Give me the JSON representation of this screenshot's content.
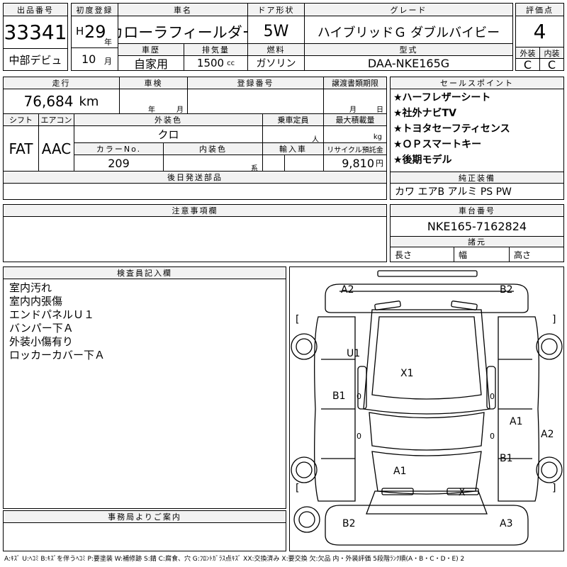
{
  "header": {
    "lot_label": "出品番号",
    "lot_no": "33341",
    "venue": "中部デビュ",
    "first_reg_label": "初度登録",
    "era": "H",
    "year": "29",
    "year_unit": "年",
    "month": "10",
    "month_unit": "月",
    "car_name_label": "車名",
    "car_name": "カローラフィールダー",
    "door_label": "ドア形状",
    "door": "5W",
    "grade_label": "グレード",
    "grade": "ハイブリッドＧ ダブルバイビー",
    "score_label": "評価点",
    "score": "4",
    "history_label": "車歴",
    "history": "自家用",
    "displacement_label": "排気量",
    "displacement": "1500",
    "displacement_unit": "cc",
    "fuel_label": "燃料",
    "fuel": "ガソリン",
    "model_label": "型式",
    "model": "DAA-NKE165G",
    "ext_label": "外装",
    "ext": "C",
    "int_label": "内装",
    "int": "C"
  },
  "specs": {
    "mileage_label": "走行",
    "mileage": "76,684",
    "mileage_unit": "km",
    "inspection_label": "車検",
    "insp_year_unit": "年",
    "insp_month_unit": "月",
    "reg_no_label": "登録番号",
    "transfer_label": "譲渡書類期限",
    "transfer_month_unit": "月",
    "transfer_day_unit": "日",
    "shift_label": "シフト",
    "shift": "FAT",
    "ac_label": "エアコン",
    "ac": "AAC",
    "color_label": "外装色",
    "color": "クロ",
    "capacity_label": "乗車定員",
    "capacity_unit": "人",
    "load_label": "最大積載量",
    "load_unit": "kg",
    "color_no_label": "カラーNo.",
    "color_no": "209",
    "int_color_label": "内装色",
    "int_color_unit": "系",
    "import_label": "輸入車",
    "recycle_label": "リサイクル預託金",
    "recycle": "9,810",
    "recycle_unit": "円",
    "later_parts_label": "後日発送部品"
  },
  "sales_points": {
    "label": "セールスポイント",
    "items": [
      "★ハーフレザーシート",
      "★社外ナビTV",
      "★トヨタセーフティセンス",
      "★ＯＰスマートキー",
      "★後期モデル"
    ]
  },
  "equipment": {
    "label": "純正装備",
    "value": "カワ エアB アルミ PS PW"
  },
  "chassis": {
    "label": "車台番号",
    "value": "NKE165-7162824"
  },
  "dims": {
    "label": "諸元",
    "length": "長さ",
    "width": "幅",
    "height": "高さ"
  },
  "notes": {
    "label": "注意事項欄"
  },
  "inspector": {
    "label": "検査員記入欄",
    "lines": [
      "室内汚れ",
      "室内内張傷",
      "エンドパネルＵ１",
      "バンパー下Ａ",
      "外装小傷有り",
      "ロッカーカバー下Ａ"
    ]
  },
  "office": {
    "label": "事務局よりご案内"
  },
  "diagram": {
    "marks": {
      "a2_tl": "A2",
      "b2_tr": "B2",
      "u1": "U1",
      "x1": "X1",
      "b1_l": "B1",
      "a1_r": "A1",
      "a2_r": "A2",
      "b1_r": "B1",
      "a1_c": "A1",
      "x_bot": "X",
      "b2_bl": "B2",
      "a3_br": "A3",
      "bracket_l": "[",
      "bracket_r": "]",
      "zero": "0"
    }
  },
  "footer": {
    "legend": "A:ｷｽﾞ U:ﾍｺﾐ B:ｷｽﾞを伴うﾍｺﾐ P:要塗装 W:補修跡 S:錆 C:腐食、穴 G:ﾌﾛﾝﾄｶﾞﾗｽ点ｷｽﾞ XX:交換済み X:要交換 欠:欠品 内・外装評価 5段階ﾗﾝｸ順(A・B・C・D・E) 2"
  }
}
